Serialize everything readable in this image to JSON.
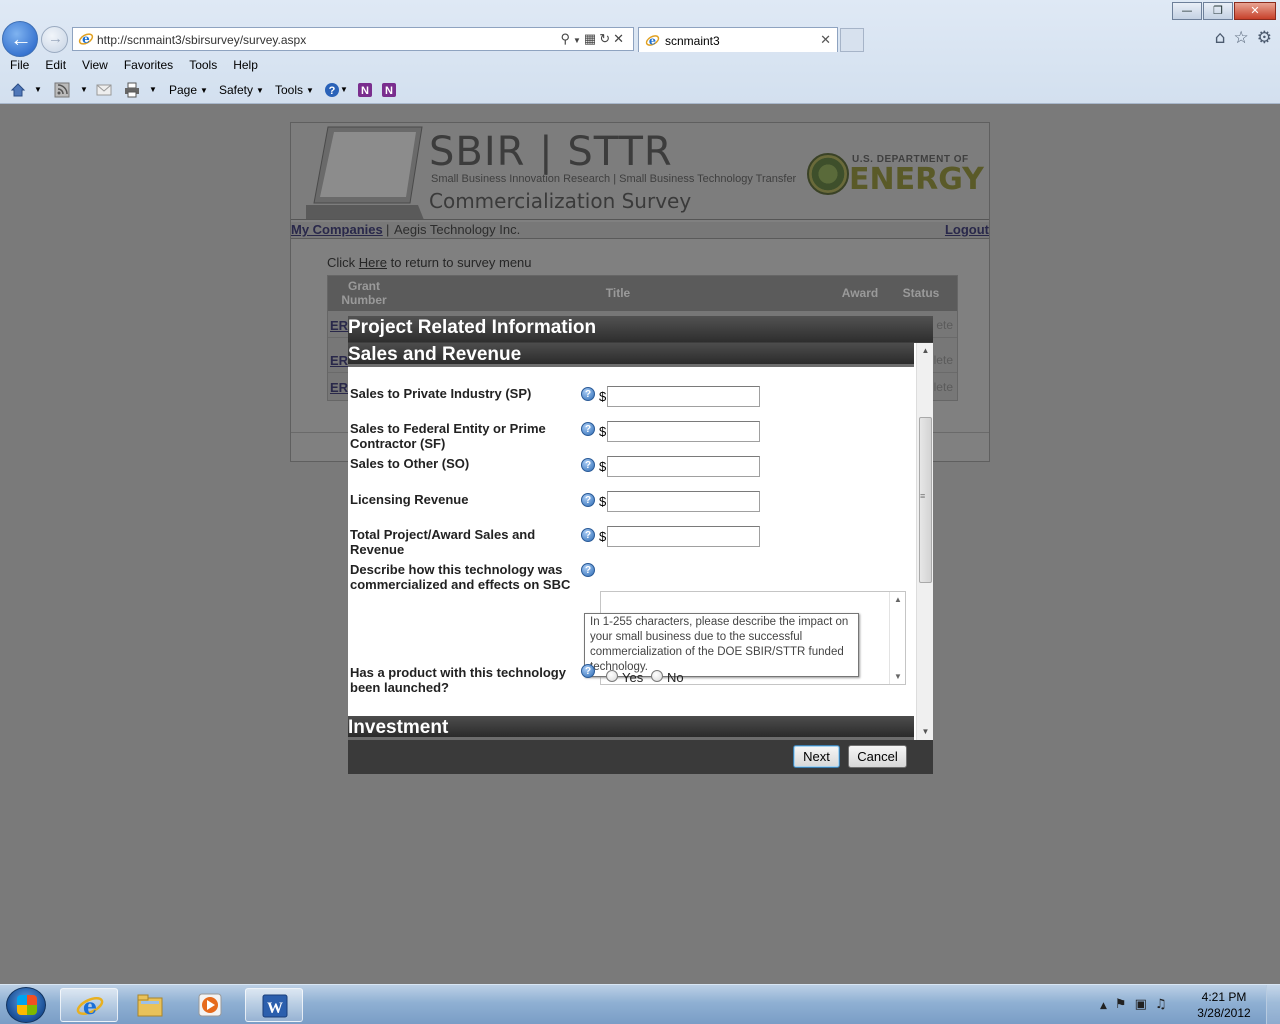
{
  "browser": {
    "address_url": "http://scnmaint3/sbirsurvey/survey.aspx",
    "tab_title": "scnmaint3",
    "menu": [
      "File",
      "Edit",
      "View",
      "Favorites",
      "Tools",
      "Help"
    ],
    "command_bar": {
      "page": "Page",
      "safety": "Safety",
      "tools": "Tools"
    }
  },
  "site": {
    "logo_title": "SBIR | STTR",
    "logo_subtitle": "Small Business Innovation Research | Small Business Technology Transfer",
    "logo_survey": "Commercialization Survey",
    "doe_us": "U.S. DEPARTMENT OF",
    "doe_energy": "ENERGY",
    "my_companies": "My Companies",
    "separator": "|",
    "company": "Aegis Technology Inc.",
    "logout": "Logout",
    "click_prefix": "Click",
    "click_link": "Here",
    "click_suffix": "to return to survey menu"
  },
  "grant_table": {
    "headers": {
      "grant": "Grant Number",
      "title": "Title",
      "award": "Award",
      "status": "Status"
    },
    "rows": [
      {
        "grant": "ER",
        "status": "ete"
      },
      {
        "grant": "ER",
        "status": "lete"
      },
      {
        "grant": "ER",
        "status": "lete"
      }
    ]
  },
  "modal": {
    "title": "Project Related Information",
    "section_sales": "Sales and Revenue",
    "section_investment": "Investment",
    "currency": "$",
    "help_glyph": "?",
    "fields": {
      "sp": "Sales to Private Industry (SP)",
      "sf": "Sales to Federal Entity or Prime Contractor (SF)",
      "so": "Sales to Other (SO)",
      "lic": "Licensing Revenue",
      "total": "Total Project/Award Sales and Revenue",
      "describe": "Describe how this technology was commercialized and effects on SBC",
      "launched": "Has a product with this technology been launched?"
    },
    "tooltip": "In 1-255 characters, please describe the impact on your small business due to the successful commercialization of the DOE SBIR/STTR funded technology.",
    "yes_label": "Yes",
    "no_label": "No",
    "next_button": "Next",
    "cancel_button": "Cancel"
  },
  "taskbar": {
    "time": "4:21 PM",
    "date": "3/28/2012"
  }
}
